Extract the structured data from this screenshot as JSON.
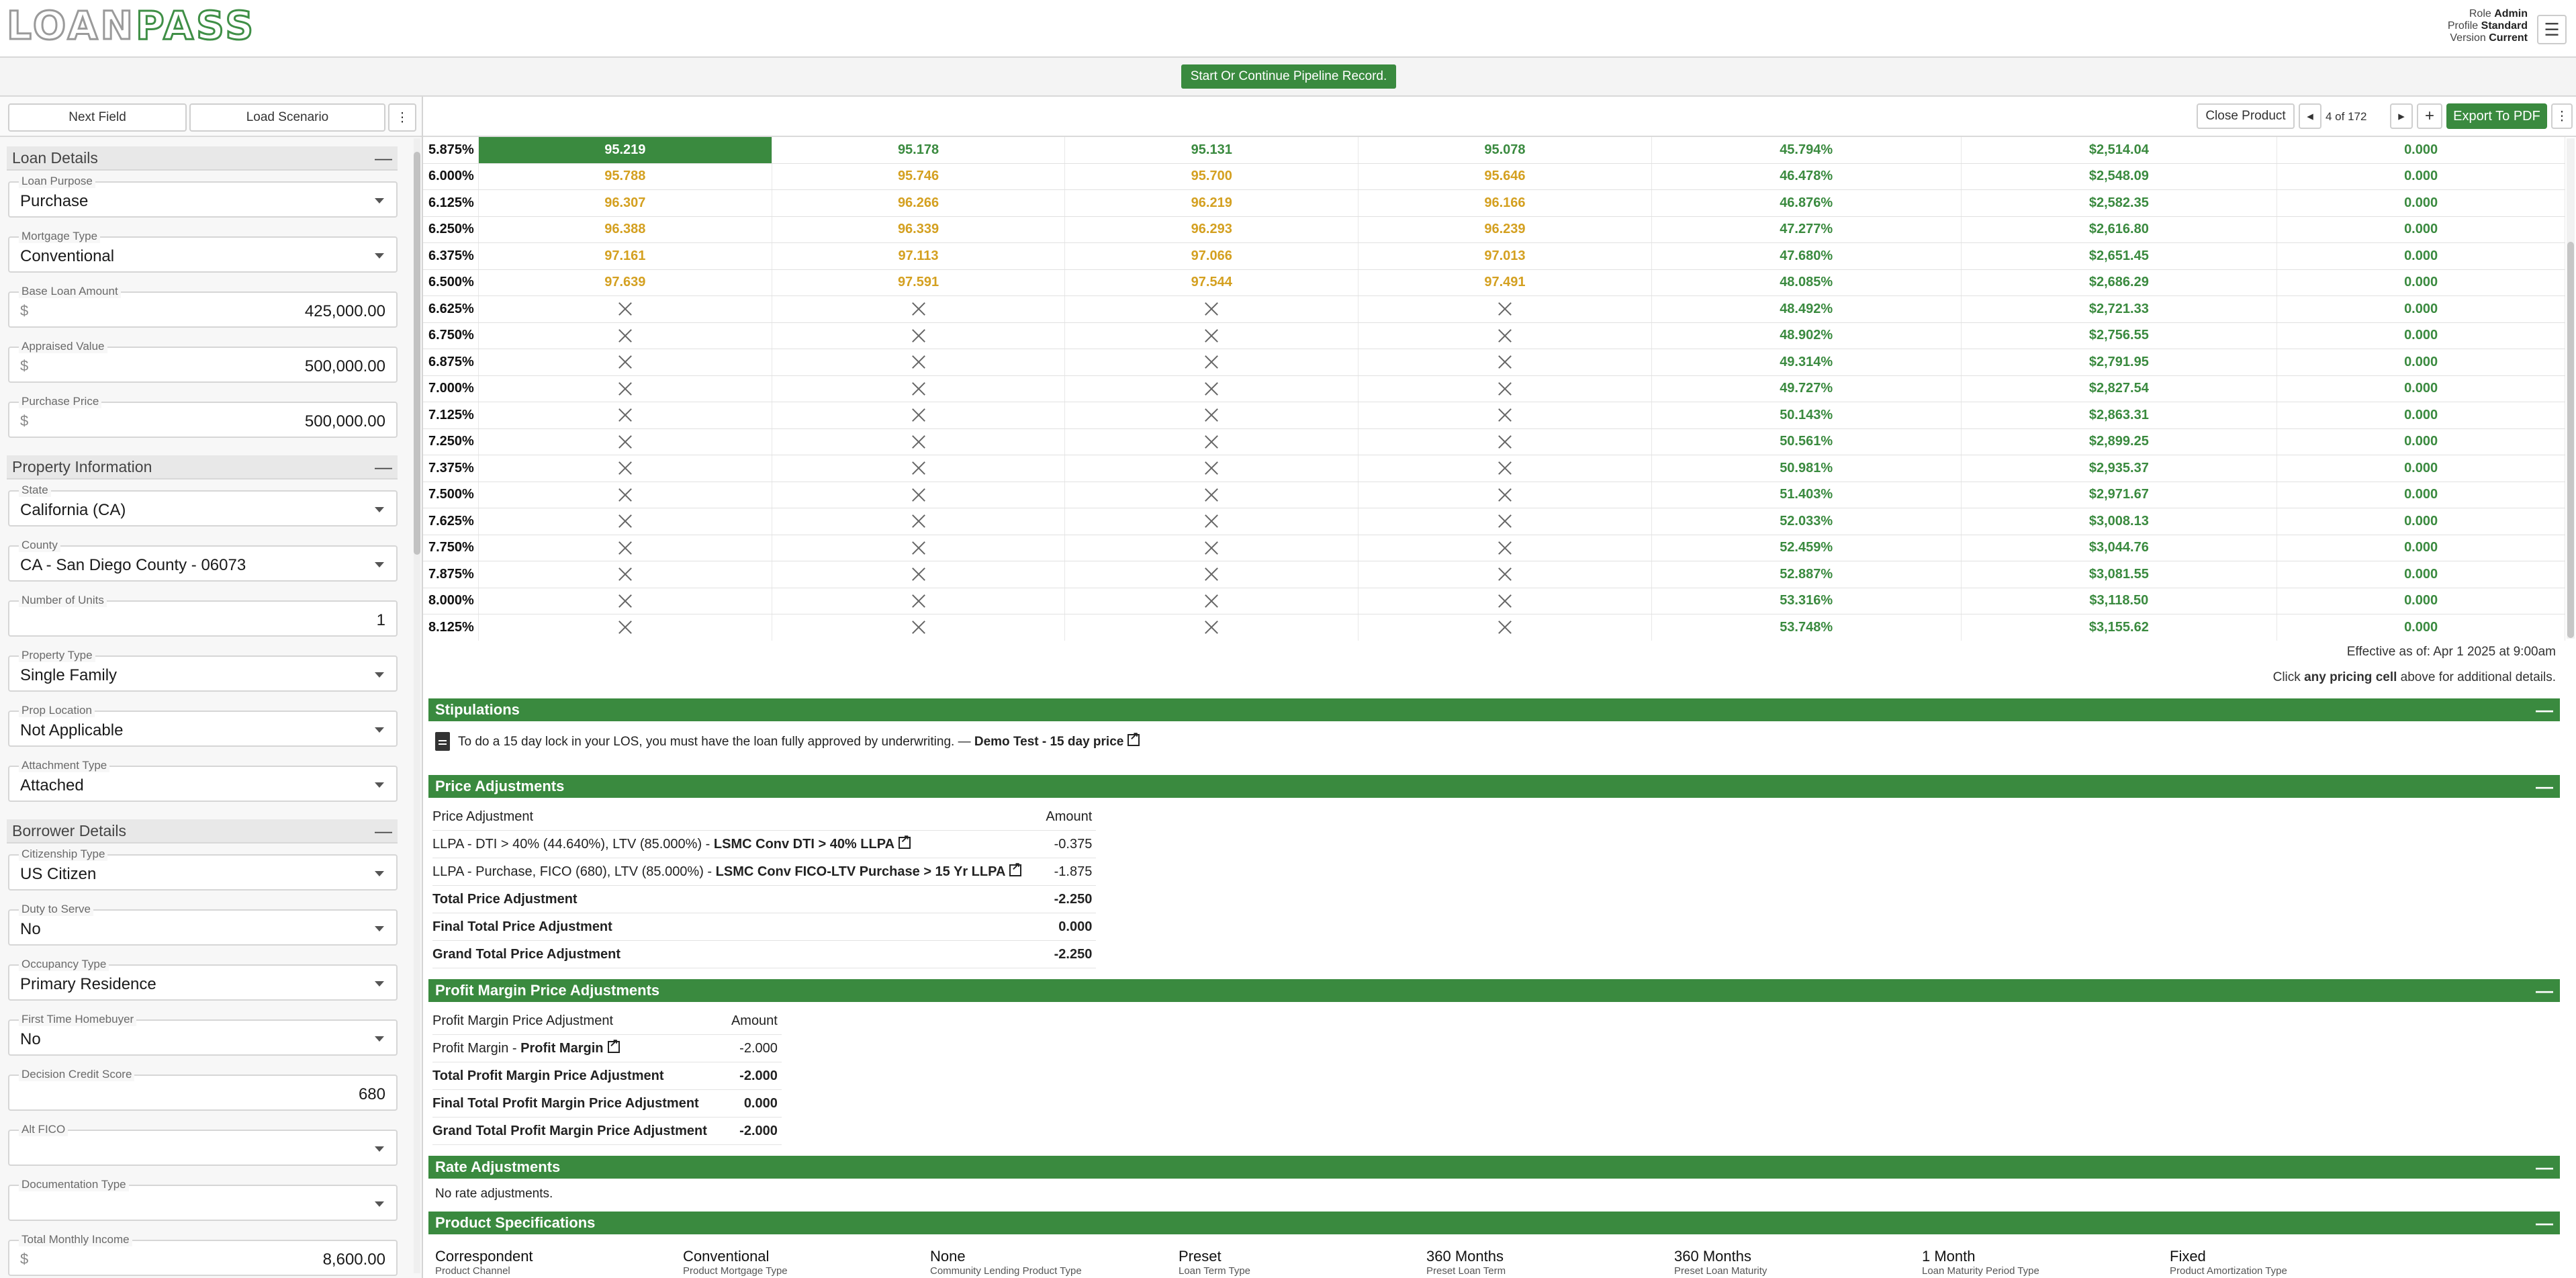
{
  "header": {
    "logo_part1": "LOAN",
    "logo_part2": "PASS",
    "role_label": "Role",
    "role_value": "Admin",
    "profile_label": "Profile",
    "profile_value": "Standard",
    "version_label": "Version",
    "version_value": "Current",
    "menu_icon": "hamburger-icon"
  },
  "pipeline": {
    "button_label": "Start Or Continue Pipeline Record."
  },
  "sidebar": {
    "next_field": "Next Field",
    "load_scenario": "Load Scenario",
    "more_icon": "⋮",
    "sections": {
      "loan_details": "Loan Details",
      "property_information": "Property Information",
      "borrower_details": "Borrower Details"
    },
    "fields": {
      "loan_purpose": {
        "label": "Loan Purpose",
        "value": "Purchase"
      },
      "mortgage_type": {
        "label": "Mortgage Type",
        "value": "Conventional"
      },
      "base_loan_amount": {
        "label": "Base Loan Amount",
        "prefix": "$",
        "value": "425,000.00"
      },
      "appraised_value": {
        "label": "Appraised Value",
        "prefix": "$",
        "value": "500,000.00"
      },
      "purchase_price": {
        "label": "Purchase Price",
        "prefix": "$",
        "value": "500,000.00"
      },
      "state": {
        "label": "State",
        "value": "California (CA)"
      },
      "county": {
        "label": "County",
        "value": "CA - San Diego County - 06073"
      },
      "number_of_units": {
        "label": "Number of Units",
        "value": "1"
      },
      "property_type": {
        "label": "Property Type",
        "value": "Single Family"
      },
      "prop_location": {
        "label": "Prop Location",
        "value": "Not Applicable"
      },
      "attachment_type": {
        "label": "Attachment Type",
        "value": "Attached"
      },
      "citizenship_type": {
        "label": "Citizenship Type",
        "value": "US Citizen"
      },
      "duty_to_serve": {
        "label": "Duty to Serve",
        "value": "No"
      },
      "occupancy_type": {
        "label": "Occupancy Type",
        "value": "Primary Residence"
      },
      "first_time_homebuyer": {
        "label": "First Time Homebuyer",
        "value": "No"
      },
      "decision_credit_score": {
        "label": "Decision Credit Score",
        "value": "680"
      },
      "alt_fico": {
        "label": "Alt FICO",
        "value": ""
      },
      "documentation_type": {
        "label": "Documentation Type",
        "value": ""
      },
      "total_monthly_income": {
        "label": "Total Monthly Income",
        "prefix": "$",
        "value": "8,600.00"
      }
    }
  },
  "toolbar": {
    "close_product": "Close Product",
    "prev_icon": "◂",
    "page_indicator": "4 of 172",
    "next_icon": "▸",
    "add_icon": "+",
    "export_pdf": "Export To PDF",
    "more_icon": "⋮"
  },
  "pricing": {
    "rows": [
      {
        "rate": "5.875%",
        "c1": "95.219",
        "c2": "95.178",
        "c3": "95.131",
        "c4": "95.078",
        "tone": "green",
        "c5": "45.794%",
        "c6": "$2,514.04",
        "c7": "0.000",
        "selected": true
      },
      {
        "rate": "6.000%",
        "c1": "95.788",
        "c2": "95.746",
        "c3": "95.700",
        "c4": "95.646",
        "tone": "gold",
        "c5": "46.478%",
        "c6": "$2,548.09",
        "c7": "0.000"
      },
      {
        "rate": "6.125%",
        "c1": "96.307",
        "c2": "96.266",
        "c3": "96.219",
        "c4": "96.166",
        "tone": "gold",
        "c5": "46.876%",
        "c6": "$2,582.35",
        "c7": "0.000"
      },
      {
        "rate": "6.250%",
        "c1": "96.388",
        "c2": "96.339",
        "c3": "96.293",
        "c4": "96.239",
        "tone": "gold",
        "c5": "47.277%",
        "c6": "$2,616.80",
        "c7": "0.000"
      },
      {
        "rate": "6.375%",
        "c1": "97.161",
        "c2": "97.113",
        "c3": "97.066",
        "c4": "97.013",
        "tone": "gold",
        "c5": "47.680%",
        "c6": "$2,651.45",
        "c7": "0.000"
      },
      {
        "rate": "6.500%",
        "c1": "97.639",
        "c2": "97.591",
        "c3": "97.544",
        "c4": "97.491",
        "tone": "gold",
        "c5": "48.085%",
        "c6": "$2,686.29",
        "c7": "0.000"
      },
      {
        "rate": "6.625%",
        "c1": "",
        "c2": "",
        "c3": "",
        "c4": "",
        "tone": "x",
        "c5": "48.492%",
        "c6": "$2,721.33",
        "c7": "0.000"
      },
      {
        "rate": "6.750%",
        "c1": "",
        "c2": "",
        "c3": "",
        "c4": "",
        "tone": "x",
        "c5": "48.902%",
        "c6": "$2,756.55",
        "c7": "0.000"
      },
      {
        "rate": "6.875%",
        "c1": "",
        "c2": "",
        "c3": "",
        "c4": "",
        "tone": "x",
        "c5": "49.314%",
        "c6": "$2,791.95",
        "c7": "0.000"
      },
      {
        "rate": "7.000%",
        "c1": "",
        "c2": "",
        "c3": "",
        "c4": "",
        "tone": "x",
        "c5": "49.727%",
        "c6": "$2,827.54",
        "c7": "0.000"
      },
      {
        "rate": "7.125%",
        "c1": "",
        "c2": "",
        "c3": "",
        "c4": "",
        "tone": "x",
        "c5": "50.143%",
        "c6": "$2,863.31",
        "c7": "0.000"
      },
      {
        "rate": "7.250%",
        "c1": "",
        "c2": "",
        "c3": "",
        "c4": "",
        "tone": "x",
        "c5": "50.561%",
        "c6": "$2,899.25",
        "c7": "0.000"
      },
      {
        "rate": "7.375%",
        "c1": "",
        "c2": "",
        "c3": "",
        "c4": "",
        "tone": "x",
        "c5": "50.981%",
        "c6": "$2,935.37",
        "c7": "0.000"
      },
      {
        "rate": "7.500%",
        "c1": "",
        "c2": "",
        "c3": "",
        "c4": "",
        "tone": "x",
        "c5": "51.403%",
        "c6": "$2,971.67",
        "c7": "0.000"
      },
      {
        "rate": "7.625%",
        "c1": "",
        "c2": "",
        "c3": "",
        "c4": "",
        "tone": "x",
        "c5": "52.033%",
        "c6": "$3,008.13",
        "c7": "0.000"
      },
      {
        "rate": "7.750%",
        "c1": "",
        "c2": "",
        "c3": "",
        "c4": "",
        "tone": "x",
        "c5": "52.459%",
        "c6": "$3,044.76",
        "c7": "0.000"
      },
      {
        "rate": "7.875%",
        "c1": "",
        "c2": "",
        "c3": "",
        "c4": "",
        "tone": "x",
        "c5": "52.887%",
        "c6": "$3,081.55",
        "c7": "0.000"
      },
      {
        "rate": "8.000%",
        "c1": "",
        "c2": "",
        "c3": "",
        "c4": "",
        "tone": "x",
        "c5": "53.316%",
        "c6": "$3,118.50",
        "c7": "0.000"
      },
      {
        "rate": "8.125%",
        "c1": "",
        "c2": "",
        "c3": "",
        "c4": "",
        "tone": "x",
        "c5": "53.748%",
        "c6": "$3,155.62",
        "c7": "0.000"
      }
    ],
    "effective": "Effective as of: Apr 1 2025 at 9:00am",
    "click_pre": "Click ",
    "click_bold": "any pricing cell",
    "click_post": " above for additional details."
  },
  "stipulations": {
    "title": "Stipulations",
    "text": "To do a 15 day lock in your LOS, you must have the loan fully approved by underwriting. — ",
    "link": "Demo Test - 15 day price"
  },
  "price_adjustments": {
    "title": "Price Adjustments",
    "col_name": "Price Adjustment",
    "col_amount": "Amount",
    "rows": [
      {
        "prefix": "LLPA - DTI > 40% (44.640%), LTV (85.000%) - ",
        "link": "LSMC Conv DTI > 40% LLPA",
        "amount": "-0.375"
      },
      {
        "prefix": "LLPA - Purchase, FICO (680), LTV (85.000%) - ",
        "link": "LSMC Conv FICO-LTV Purchase > 15 Yr LLPA",
        "amount": "-1.875"
      }
    ],
    "totals": [
      {
        "label": "Total Price Adjustment",
        "amount": "-2.250"
      },
      {
        "label": "Final Total Price Adjustment",
        "amount": "0.000"
      },
      {
        "label": "Grand Total Price Adjustment",
        "amount": "-2.250"
      }
    ]
  },
  "profit_margin": {
    "title": "Profit Margin Price Adjustments",
    "col_name": "Profit Margin Price Adjustment",
    "col_amount": "Amount",
    "row_prefix": "Profit Margin - ",
    "row_link": "Profit Margin",
    "row_amount": "-2.000",
    "totals": [
      {
        "label": "Total Profit Margin Price Adjustment",
        "amount": "-2.000"
      },
      {
        "label": "Final Total Profit Margin Price Adjustment",
        "amount": "0.000"
      },
      {
        "label": "Grand Total Profit Margin Price Adjustment",
        "amount": "-2.000"
      }
    ]
  },
  "rate_adjustments": {
    "title": "Rate Adjustments",
    "text": "No rate adjustments."
  },
  "product_specs": {
    "title": "Product Specifications",
    "items": [
      {
        "value": "Correspondent",
        "label": "Product Channel"
      },
      {
        "value": "Conventional",
        "label": "Product Mortgage Type"
      },
      {
        "value": "None",
        "label": "Community Lending Product Type"
      },
      {
        "value": "Preset",
        "label": "Loan Term Type"
      },
      {
        "value": "360 Months",
        "label": "Preset Loan Term"
      },
      {
        "value": "360 Months",
        "label": "Preset Loan Maturity"
      },
      {
        "value": "1 Month",
        "label": "Loan Maturity Period Type"
      },
      {
        "value": "Fixed",
        "label": "Product Amortization Type"
      }
    ]
  },
  "colors": {
    "accent_green": "#3a8a3f",
    "gold": "#d4a020"
  }
}
